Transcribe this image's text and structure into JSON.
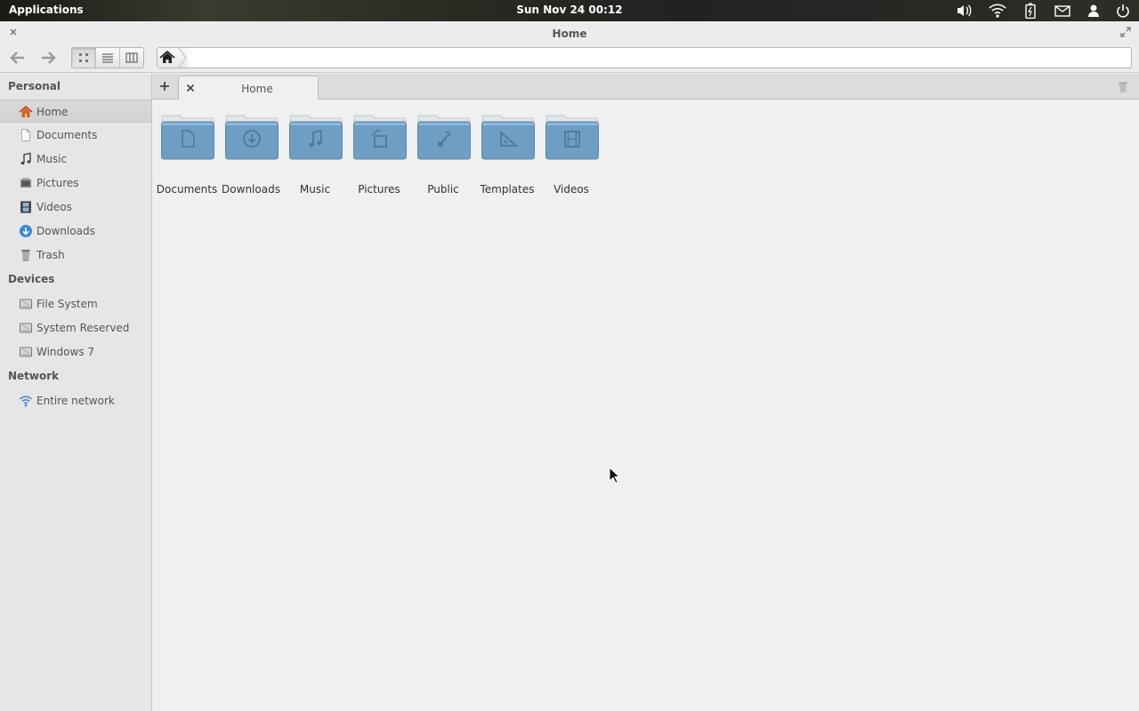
{
  "panel": {
    "applications_label": "Applications",
    "clock": "Sun Nov 24 00:12",
    "indicators": [
      "volume-icon",
      "wifi-icon",
      "battery-icon",
      "mail-icon",
      "user-icon",
      "power-icon"
    ]
  },
  "window": {
    "title": "Home"
  },
  "toolbar": {
    "view_modes": [
      "icon-view",
      "list-view",
      "column-view"
    ],
    "active_view": "icon-view"
  },
  "sidebar": {
    "sections": [
      {
        "title": "Personal",
        "items": [
          {
            "label": "Home",
            "icon": "home-icon",
            "selected": true
          },
          {
            "label": "Documents",
            "icon": "document-icon"
          },
          {
            "label": "Music",
            "icon": "music-icon"
          },
          {
            "label": "Pictures",
            "icon": "pictures-icon"
          },
          {
            "label": "Videos",
            "icon": "video-icon"
          },
          {
            "label": "Downloads",
            "icon": "download-icon"
          },
          {
            "label": "Trash",
            "icon": "trash-icon"
          }
        ]
      },
      {
        "title": "Devices",
        "items": [
          {
            "label": "File System",
            "icon": "drive-icon"
          },
          {
            "label": "System Reserved",
            "icon": "drive-icon"
          },
          {
            "label": "Windows 7",
            "icon": "drive-icon"
          }
        ]
      },
      {
        "title": "Network",
        "items": [
          {
            "label": "Entire network",
            "icon": "network-icon"
          }
        ]
      }
    ]
  },
  "tabs": [
    {
      "label": "Home",
      "active": true
    }
  ],
  "folders": [
    {
      "label": "Documents",
      "icon": "document-icon"
    },
    {
      "label": "Downloads",
      "icon": "download-icon"
    },
    {
      "label": "Music",
      "icon": "music-icon"
    },
    {
      "label": "Pictures",
      "icon": "pictures-icon"
    },
    {
      "label": "Public",
      "icon": "share-icon"
    },
    {
      "label": "Templates",
      "icon": "template-icon"
    },
    {
      "label": "Videos",
      "icon": "video-icon"
    }
  ],
  "colors": {
    "folder_blue": "#6f9ec4",
    "folder_tab": "#dfe3e6",
    "download_blue": "#3c88d6",
    "wifi_blue": "#3c88d6",
    "home_red": "#c0392b"
  }
}
